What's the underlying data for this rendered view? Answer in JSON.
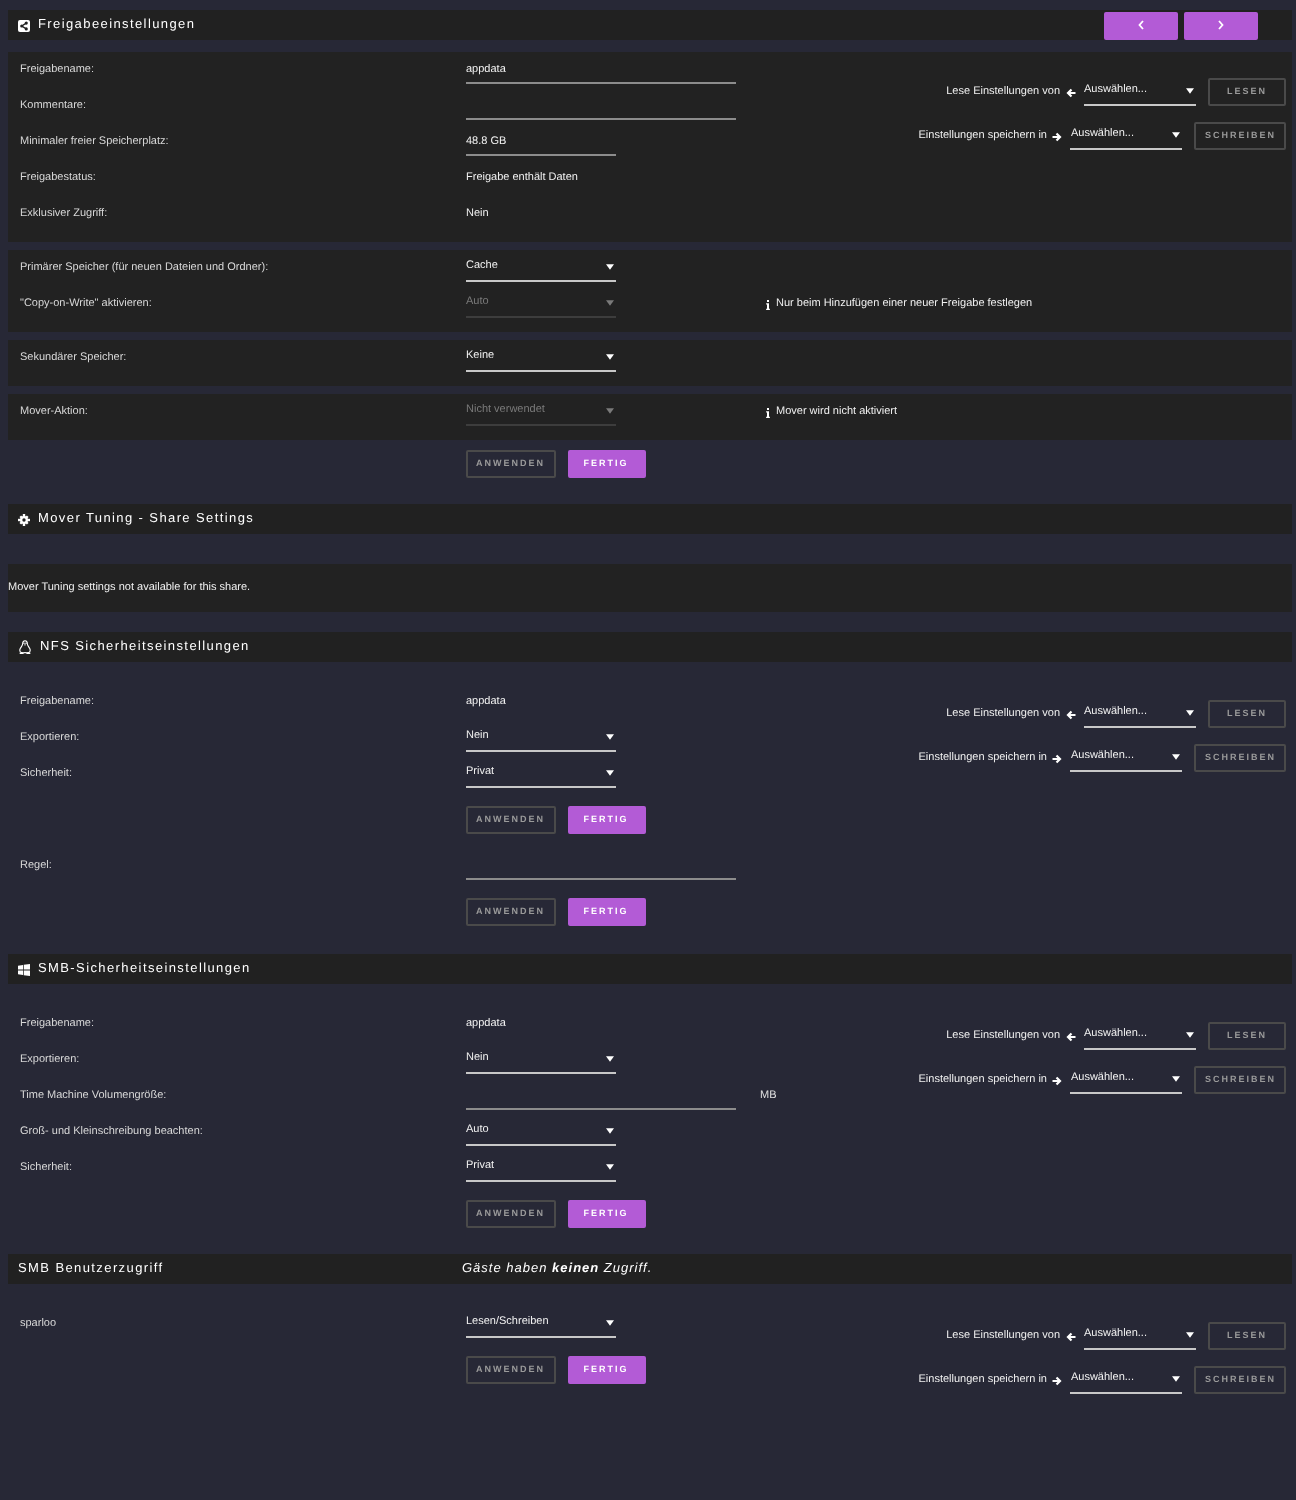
{
  "sections": [
    {
      "kind": "share",
      "title": "Freigabeeinstellungen",
      "blocks": [
        {
          "kind": "panel",
          "rows": [
            {
              "label": "Freigabename:",
              "kind": "input",
              "value": "appdata",
              "disabled": false
            },
            {
              "label": "Kommentare:",
              "kind": "input",
              "disabled": false
            },
            {
              "label": "Minimaler freier Speicherplatz:",
              "kind": "shortinput",
              "value": "48.8 GB",
              "disabled": false
            },
            {
              "label": "Freigabestatus:",
              "kind": "text",
              "value": "Freigabe enthält Daten",
              "disabled": false
            },
            {
              "label": "Exklusiver Zugriff:",
              "kind": "text",
              "value": "Nein",
              "disabled": false
            }
          ],
          "clone": [
            {
              "kind": "read",
              "label": "Lese Einstellungen von",
              "select": "Auswählen...",
              "button": "LESEN",
              "disabled": true
            },
            {
              "kind": "write",
              "label": "Einstellungen speichern in",
              "select": "Auswählen...",
              "button": "SCHREIBEN",
              "disabled": true
            }
          ]
        },
        {
          "kind": "panel",
          "rows": [
            {
              "label": "Primärer Speicher (für neuen Dateien und Ordner):",
              "kind": "select",
              "value": "Cache",
              "disabled": false
            },
            {
              "label": "\"Copy-on-Write\" aktivieren:",
              "kind": "select",
              "value": "Auto",
              "disabled": true,
              "note": "Nur beim Hinzufügen einer neuer Freigabe festlegen"
            }
          ]
        },
        {
          "kind": "panel",
          "rows": [
            {
              "label": "Sekundärer Speicher:",
              "kind": "select",
              "value": "Keine",
              "disabled": false
            }
          ]
        },
        {
          "kind": "panel",
          "rows": [
            {
              "label": "Mover-Aktion:",
              "kind": "select",
              "value": "Nicht verwendet",
              "disabled": true,
              "note": "Mover wird nicht aktiviert"
            }
          ]
        },
        {
          "kind": "plain",
          "buttons": [
            {
              "label": "ANWENDEN",
              "disabled": true
            },
            {
              "label": "FERTIG",
              "disabled": false
            }
          ]
        }
      ]
    },
    {
      "kind": "mover_tuning",
      "title": "Mover Tuning - Share Settings",
      "blocks": [
        {
          "kind": "panel",
          "message": "Mover Tuning settings not available for this share."
        }
      ]
    },
    {
      "kind": "nfs",
      "title": "NFS Sicherheitseinstellungen",
      "blocks": [
        {
          "kind": "plain",
          "rows": [
            {
              "label": "Freigabename:",
              "kind": "text",
              "value": "appdata",
              "disabled": false
            },
            {
              "label": "Exportieren:",
              "kind": "select",
              "value": "Nein",
              "disabled": false
            },
            {
              "label": "Sicherheit:",
              "kind": "select",
              "value": "Privat",
              "disabled": false
            }
          ],
          "buttons": [
            {
              "label": "ANWENDEN",
              "disabled": true
            },
            {
              "label": "FERTIG",
              "disabled": false
            }
          ],
          "clone": [
            {
              "kind": "read",
              "label": "Lese Einstellungen von",
              "select": "Auswählen...",
              "button": "LESEN",
              "disabled": true
            },
            {
              "kind": "write",
              "label": "Einstellungen speichern in",
              "select": "Auswählen...",
              "button": "SCHREIBEN",
              "disabled": true
            }
          ]
        },
        {
          "kind": "plain",
          "rows": [
            {
              "label": "Regel:",
              "kind": "input",
              "disabled": false
            }
          ],
          "buttons": [
            {
              "label": "ANWENDEN",
              "disabled": true
            },
            {
              "label": "FERTIG",
              "disabled": false
            }
          ]
        }
      ]
    },
    {
      "kind": "smb",
      "title": "SMB-Sicherheitseinstellungen",
      "blocks": [
        {
          "kind": "plain",
          "rows": [
            {
              "label": "Freigabename:",
              "kind": "text",
              "value": "appdata",
              "disabled": false
            },
            {
              "label": "Exportieren:",
              "kind": "select",
              "value": "Nein",
              "disabled": false
            },
            {
              "label": "Time Machine Volumengröße:",
              "kind": "input",
              "unit": "MB",
              "disabled": false
            },
            {
              "label": "Groß- und Kleinschreibung beachten:",
              "kind": "select",
              "value": "Auto",
              "disabled": false
            },
            {
              "label": "Sicherheit:",
              "kind": "select",
              "value": "Privat",
              "disabled": false
            }
          ],
          "buttons": [
            {
              "label": "ANWENDEN",
              "disabled": true
            },
            {
              "label": "FERTIG",
              "disabled": false
            }
          ],
          "clone": [
            {
              "kind": "read",
              "label": "Lese Einstellungen von",
              "select": "Auswählen...",
              "button": "LESEN",
              "disabled": true
            },
            {
              "kind": "write",
              "label": "Einstellungen speichern in",
              "select": "Auswählen...",
              "button": "SCHREIBEN",
              "disabled": true
            }
          ]
        }
      ]
    },
    {
      "kind": "smb_users",
      "title": "SMB Benutzerzugriff",
      "note": "Gäste haben **keinen** Zugriff.",
      "blocks": [
        {
          "kind": "plain",
          "rows": [
            {
              "label": "sparloo",
              "kind": "select",
              "value": "Lesen/Schreiben",
              "disabled": false
            }
          ],
          "buttons": [
            {
              "label": "ANWENDEN",
              "disabled": true
            },
            {
              "label": "FERTIG",
              "disabled": false
            }
          ],
          "clone": [
            {
              "kind": "read",
              "label": "Lese Einstellungen von",
              "select": "Auswählen...",
              "button": "LESEN",
              "disabled": true
            },
            {
              "kind": "write",
              "label": "Einstellungen speichern in",
              "select": "Auswählen...",
              "button": "SCHREIBEN",
              "disabled": true
            }
          ]
        }
      ]
    }
  ]
}
